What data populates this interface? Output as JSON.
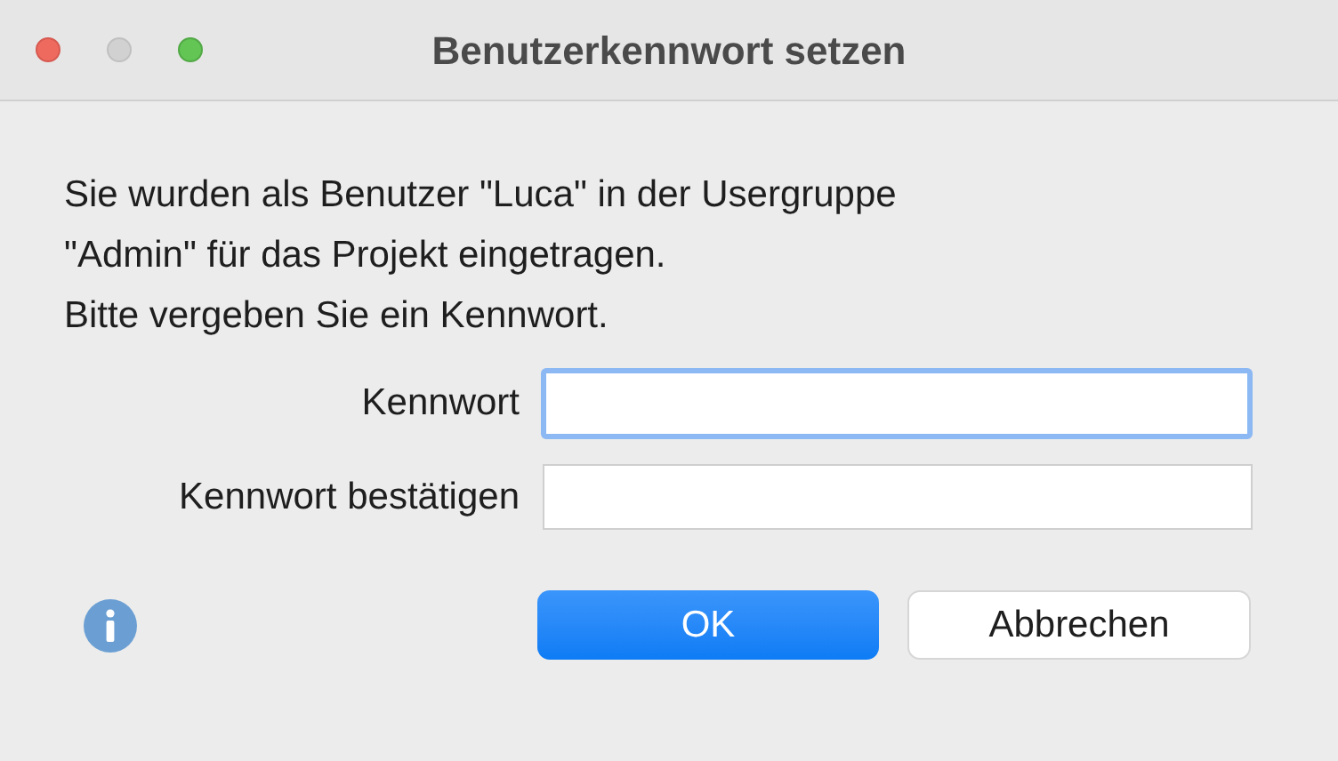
{
  "window": {
    "title": "Benutzerkennwort setzen"
  },
  "message": [
    "Sie wurden als Benutzer \"Luca\" in der Usergruppe",
    "\"Admin\" für das Projekt eingetragen.",
    "Bitte vergeben Sie ein Kennwort."
  ],
  "fields": [
    {
      "label": "Kennwort",
      "focused": true
    },
    {
      "label": "Kennwort bestätigen",
      "focused": false
    }
  ],
  "buttons": [
    {
      "label": "OK",
      "kind": "primary"
    },
    {
      "label": "Abbrechen",
      "kind": "secondary"
    }
  ]
}
